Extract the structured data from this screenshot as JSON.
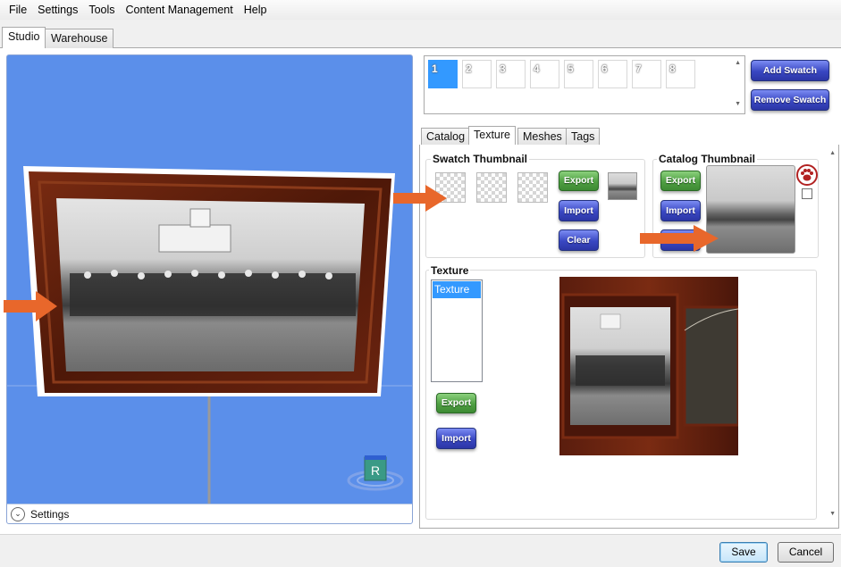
{
  "menu": [
    "File",
    "Settings",
    "Tools",
    "Content Management",
    "Help"
  ],
  "top_tabs": [
    {
      "label": "Studio",
      "active": true
    },
    {
      "label": "Warehouse",
      "active": false
    }
  ],
  "viewport": {
    "settings_label": "Settings",
    "cube_label": "R"
  },
  "swatches": {
    "items": [
      "1",
      "2",
      "3",
      "4",
      "5",
      "6",
      "7",
      "8"
    ],
    "selected": "1",
    "add_label": "Add Swatch",
    "remove_label": "Remove Swatch"
  },
  "sub_tabs": [
    {
      "label": "Catalog",
      "active": false
    },
    {
      "label": "Texture",
      "active": true
    },
    {
      "label": "Meshes",
      "active": false
    },
    {
      "label": "Tags",
      "active": false
    }
  ],
  "swatch_thumbnail": {
    "title": "Swatch Thumbnail",
    "export_label": "Export",
    "import_label": "Import",
    "clear_label": "Clear"
  },
  "catalog_thumbnail": {
    "title": "Catalog Thumbnail",
    "export_label": "Export",
    "import_label": "Import"
  },
  "texture": {
    "title": "Texture",
    "list_items": [
      "Texture"
    ],
    "export_label": "Export",
    "import_label": "Import"
  },
  "actions": {
    "save_label": "Save",
    "cancel_label": "Cancel"
  },
  "colors": {
    "viewport_bg": "#5b8fea",
    "selected_swatch": "#3399ff",
    "annotation_arrow": "#e8672b",
    "frame_wood": "#5a1d0e",
    "pet_icon": "#b22222"
  },
  "icons": [
    "chevron-down-icon",
    "paw-icon",
    "r-cube-icon",
    "scroll-up-icon",
    "scroll-down-icon",
    "annotation-arrow-icon"
  ]
}
